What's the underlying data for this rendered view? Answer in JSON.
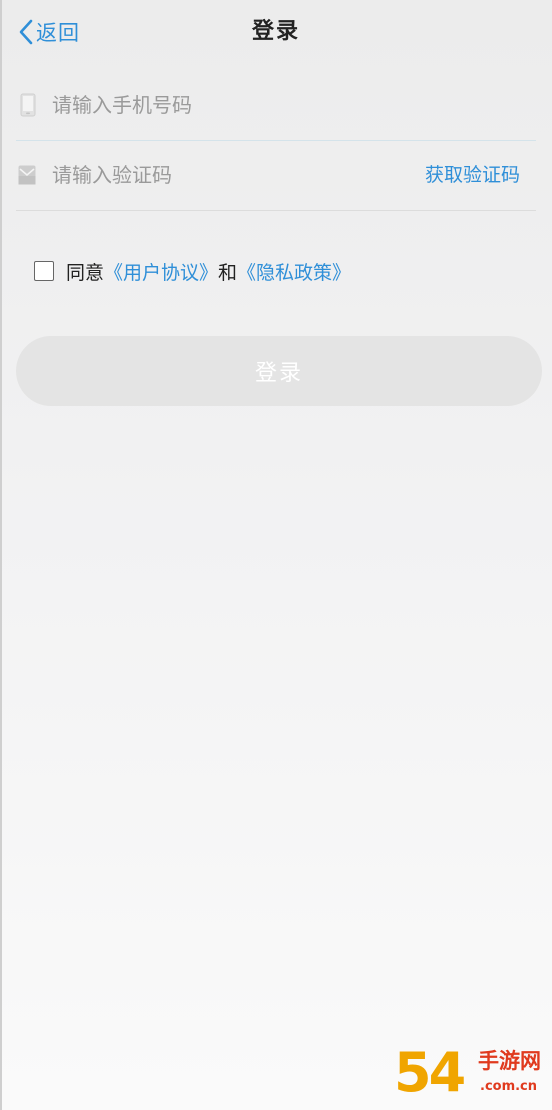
{
  "header": {
    "back_label": "返回",
    "title": "登录"
  },
  "form": {
    "phone": {
      "placeholder": "请输入手机号码",
      "value": "",
      "icon": "phone-icon"
    },
    "code": {
      "placeholder": "请输入验证码",
      "value": "",
      "icon": "envelope-icon",
      "get_code_label": "获取验证码"
    }
  },
  "agreement": {
    "checked": false,
    "prefix": "同意",
    "user_agreement": "《用户协议》",
    "conjunction": "和",
    "privacy_policy": "《隐私政策》"
  },
  "login_button": {
    "label": "登录",
    "enabled": false
  },
  "watermark": {
    "logo": "54",
    "name": "手游网",
    "domain": ".com.cn"
  },
  "colors": {
    "accent": "#2f8fd8",
    "button_disabled": "#e4e4e4",
    "watermark_orange": "#f0a500",
    "watermark_red": "#e03a1e"
  }
}
